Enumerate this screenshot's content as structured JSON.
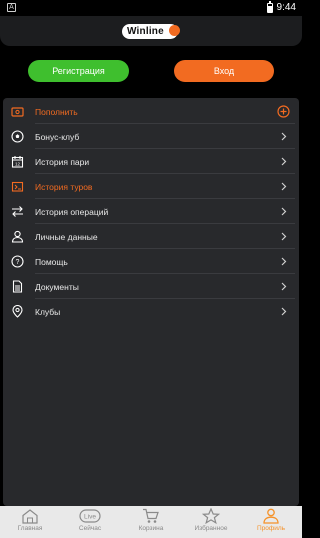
{
  "status_bar": {
    "time": "9:44",
    "indicator": "A"
  },
  "header": {
    "logo_text": "Winline"
  },
  "auth": {
    "register_label": "Регистрация",
    "login_label": "Вход"
  },
  "menu": {
    "items": [
      {
        "label": "Пополнить",
        "icon": "wallet-icon",
        "accent": true,
        "action": "plus"
      },
      {
        "label": "Бонус-клуб",
        "icon": "soccer-ball-icon",
        "accent": false,
        "action": "chevron"
      },
      {
        "label": "История пари",
        "icon": "calendar-icon",
        "accent": false,
        "action": "chevron"
      },
      {
        "label": "История туров",
        "icon": "tours-icon",
        "accent": true,
        "action": "chevron"
      },
      {
        "label": "История операций",
        "icon": "transfer-arrows-icon",
        "accent": false,
        "action": "chevron"
      },
      {
        "label": "Личные данные",
        "icon": "user-icon",
        "accent": false,
        "action": "chevron"
      },
      {
        "label": "Помощь",
        "icon": "help-icon",
        "accent": false,
        "action": "chevron"
      },
      {
        "label": "Документы",
        "icon": "document-icon",
        "accent": false,
        "action": "chevron"
      },
      {
        "label": "Клубы",
        "icon": "club-icon",
        "accent": false,
        "action": "chevron"
      }
    ]
  },
  "tabbar": {
    "tabs": [
      {
        "label": "Главная",
        "icon": "home-icon",
        "active": false
      },
      {
        "label": "Сейчас",
        "icon": "live-icon",
        "active": false,
        "badge": "Live"
      },
      {
        "label": "Корзина",
        "icon": "cart-icon",
        "active": false
      },
      {
        "label": "Избранное",
        "icon": "star-icon",
        "active": false
      },
      {
        "label": "Профиль",
        "icon": "profile-icon",
        "active": true
      }
    ]
  },
  "colors": {
    "accent": "#f26b21",
    "green": "#3fbf2e",
    "panel": "#28292c",
    "active_tab": "#f5922a"
  }
}
